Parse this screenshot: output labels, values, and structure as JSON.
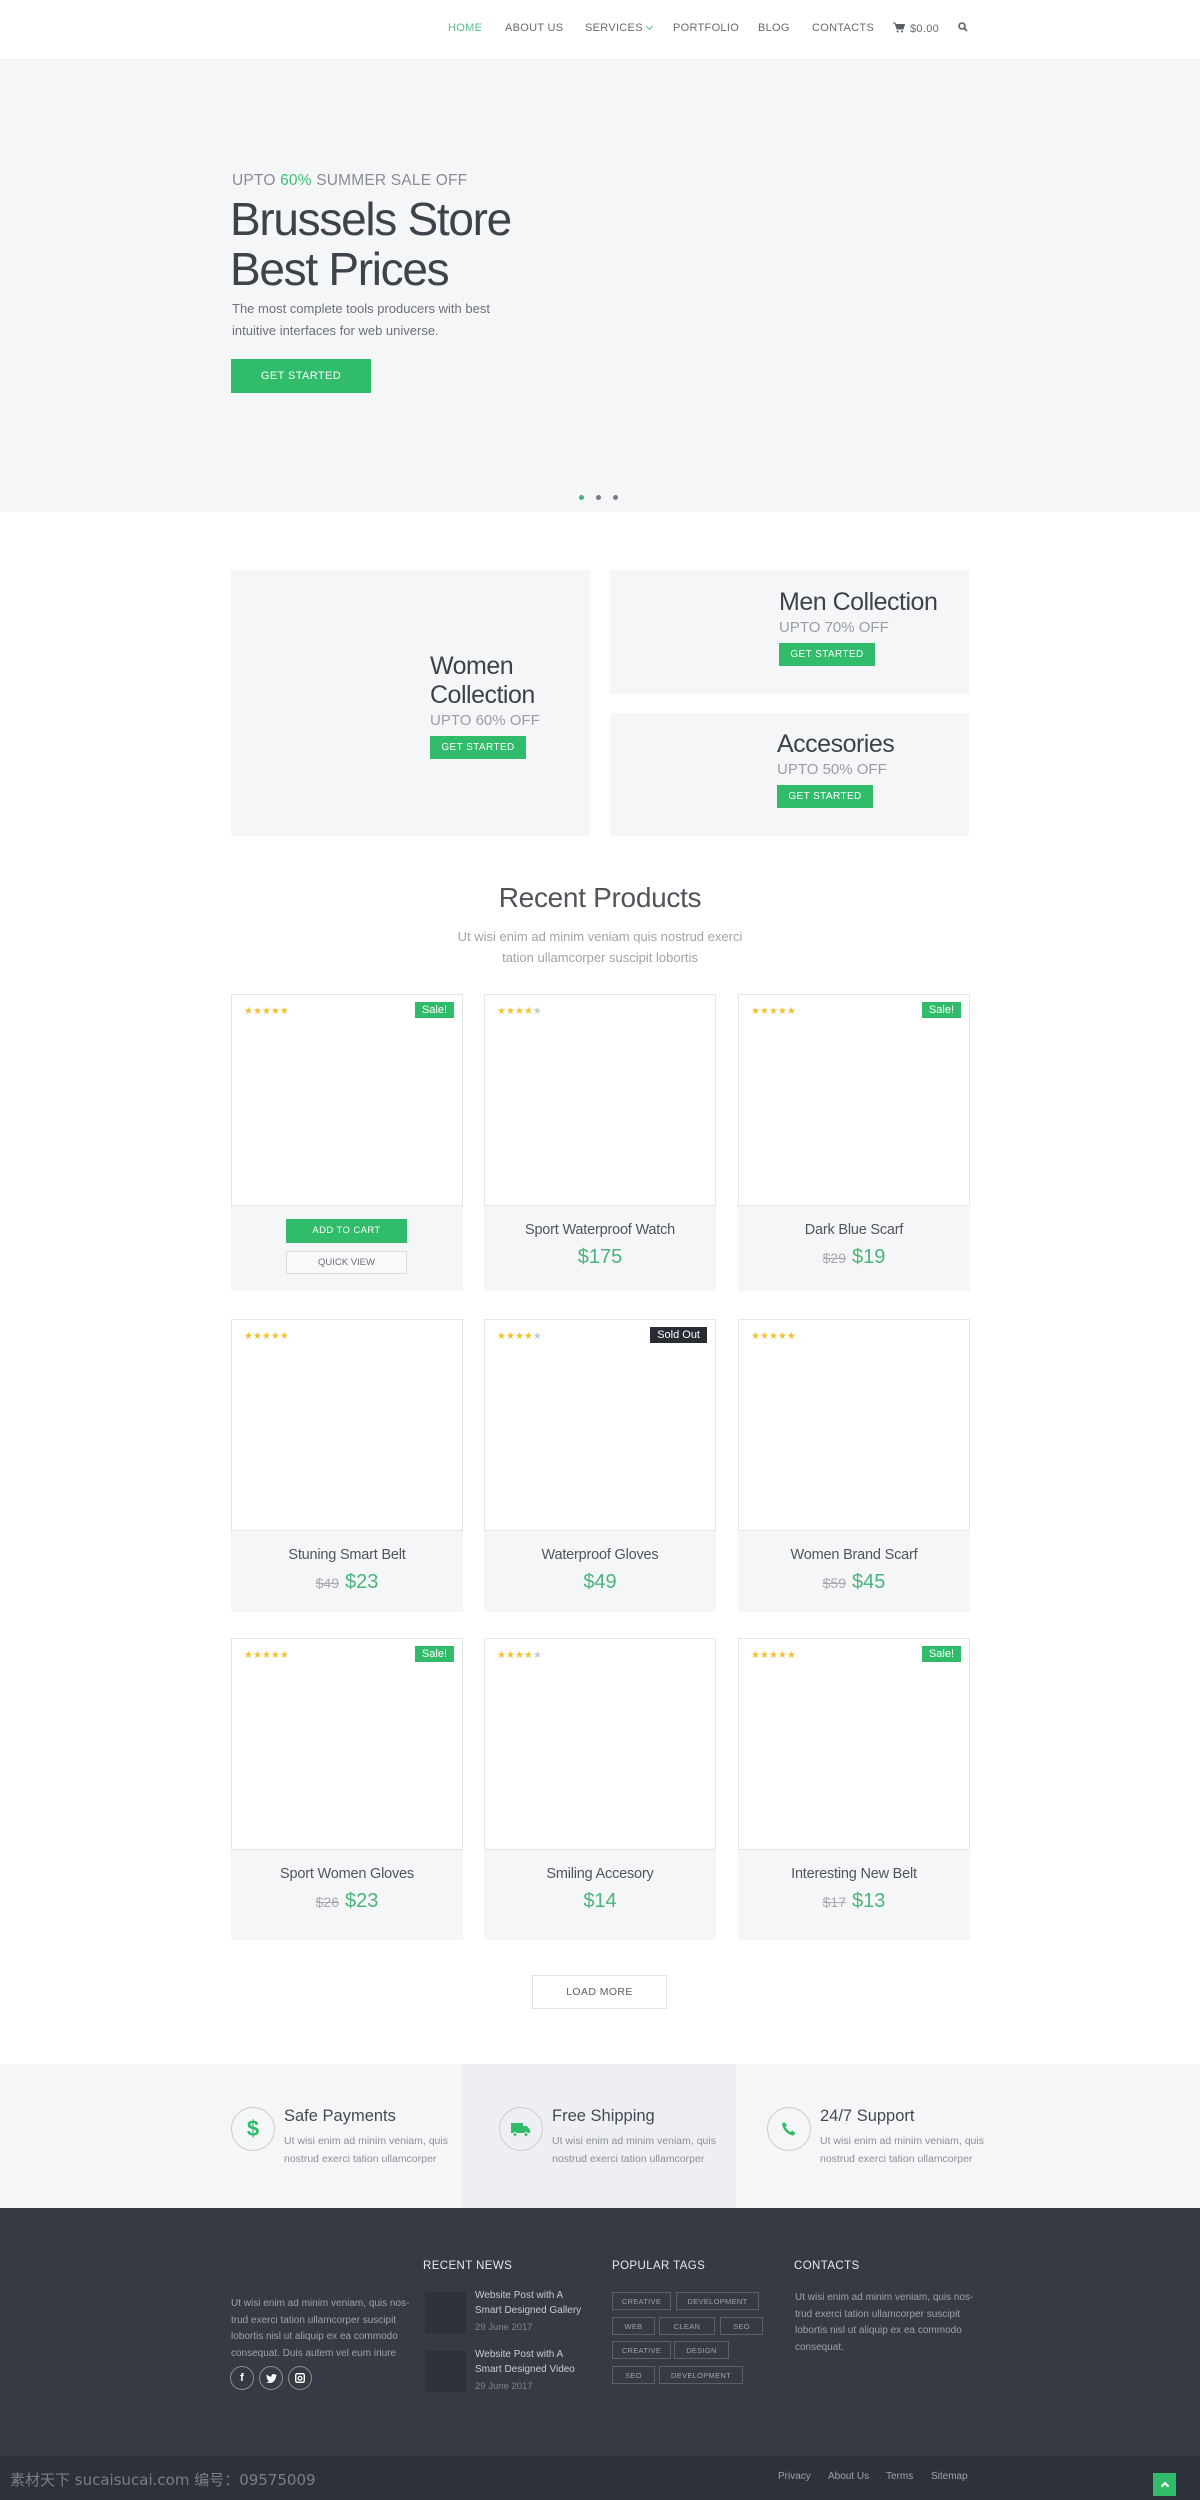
{
  "nav": {
    "items": [
      {
        "label": "HOME",
        "active": true
      },
      {
        "label": "ABOUT US"
      },
      {
        "label": "SERVICES"
      },
      {
        "label": "PORTFOLIO"
      },
      {
        "label": "BLOG"
      },
      {
        "label": "CONTACTS"
      }
    ],
    "cart_total": "$0.00",
    "cart_icon": "cart-icon",
    "search_icon": "search-icon"
  },
  "hero": {
    "pre_a": "UPTO ",
    "pre_highlight": "60%",
    "pre_b": " SUMMER SALE OFF",
    "title_line1": "Brussels Store",
    "title_line2": "Best Prices",
    "desc_line1": "The most complete tools producers with best",
    "desc_line2": "intuitive interfaces for web universe.",
    "button": "GET STARTED",
    "slides": 3,
    "active_slide": 1
  },
  "collections": [
    {
      "title_line1": "Women",
      "title_line2": "Collection",
      "offer": "UPTO 60% OFF",
      "button": "GET STARTED"
    },
    {
      "title": "Men Collection",
      "offer": "UPTO 70% OFF",
      "button": "GET STARTED"
    },
    {
      "title": "Accesories",
      "offer": "UPTO 50% OFF",
      "button": "GET STARTED"
    }
  ],
  "recent": {
    "title": "Recent Products",
    "sub_line1": "Ut wisi enim ad minim veniam quis nostrud exerci",
    "sub_line2": "tation ullamcorper suscipit lobortis",
    "add_to_cart": "ADD TO CART",
    "quick_view": "QUICK VIEW",
    "load_more": "LOAD MORE",
    "products": [
      {
        "name": "",
        "rating": 5,
        "badge": "Sale!",
        "hover": true
      },
      {
        "name": "Sport Waterproof Watch",
        "rating": 4,
        "badge": "",
        "old_price": "",
        "price": "$175"
      },
      {
        "name": "Dark Blue Scarf",
        "rating": 5,
        "badge": "Sale!",
        "old_price": "$29",
        "price": "$19"
      },
      {
        "name": "Stuning Smart Belt",
        "rating": 5,
        "badge": "",
        "old_price": "$49",
        "price": "$23"
      },
      {
        "name": "Waterproof Gloves",
        "rating": 4,
        "badge": "Sold Out",
        "old_price": "",
        "price": "$49"
      },
      {
        "name": "Women Brand Scarf",
        "rating": 5,
        "badge": "",
        "old_price": "$59",
        "price": "$45"
      },
      {
        "name": "Sport Women Gloves",
        "rating": 5,
        "badge": "Sale!",
        "old_price": "$26",
        "price": "$23"
      },
      {
        "name": "Smiling Accesory",
        "rating": 4,
        "badge": "",
        "old_price": "",
        "price": "$14"
      },
      {
        "name": "Interesting New Belt",
        "rating": 5,
        "badge": "Sale!",
        "old_price": "$17",
        "price": "$13"
      }
    ]
  },
  "features": [
    {
      "icon": "dollar-icon",
      "title": "Safe Payments",
      "line1": "Ut wisi enim ad minim veniam, quis",
      "line2": "nostrud exerci tation ullamcorper"
    },
    {
      "icon": "truck-icon",
      "title": "Free Shipping",
      "line1": "Ut wisi enim ad minim veniam, quis",
      "line2": "nostrud exerci tation ullamcorper"
    },
    {
      "icon": "phone-icon",
      "title": "24/7 Support",
      "line1": "Ut wisi enim ad minim veniam, quis",
      "line2": "nostrud exerci tation ullamcorper"
    }
  ],
  "footer": {
    "about": [
      "Ut wisi enim ad minim veniam, quis nos-",
      "trud exerci tation ullamcorper suscipit",
      "lobortis nisl ut aliquip ex ea commodo",
      "consequat. Duis autem vel eum iriure"
    ],
    "social": [
      "f",
      "t",
      "ig"
    ],
    "news_title": "RECENT NEWS",
    "news": [
      {
        "line1": "Website Post with A",
        "line2": "Smart Designed Gallery",
        "date": "29 June 2017"
      },
      {
        "line1": "Website Post with A",
        "line2": "Smart Designed Video",
        "date": "29 June 2017"
      }
    ],
    "tags_title": "POPULAR TAGS",
    "tags": [
      "CREATIVE",
      "DEVELOPMENT",
      "WEB",
      "CLEAN",
      "SEO",
      "CREATIVE",
      "DESIGN",
      "SEO",
      "DEVELOPMENT"
    ],
    "contacts_title": "CONTACTS",
    "contacts": [
      "Ut wisi enim ad minim veniam, quis nos-",
      "trud exerci tation ullamcorper suscipit",
      "lobortis nisl ut aliquip ex ea commodo",
      "consequat."
    ],
    "links": [
      "Privacy",
      "About Us",
      "Terms",
      "Sitemap"
    ],
    "watermark": "素材天下 sucaisucai.com  编号：09575009"
  },
  "colors": {
    "accent": "#31bc6b",
    "dark": "#353a43",
    "light_bg": "#f5f6f8"
  }
}
